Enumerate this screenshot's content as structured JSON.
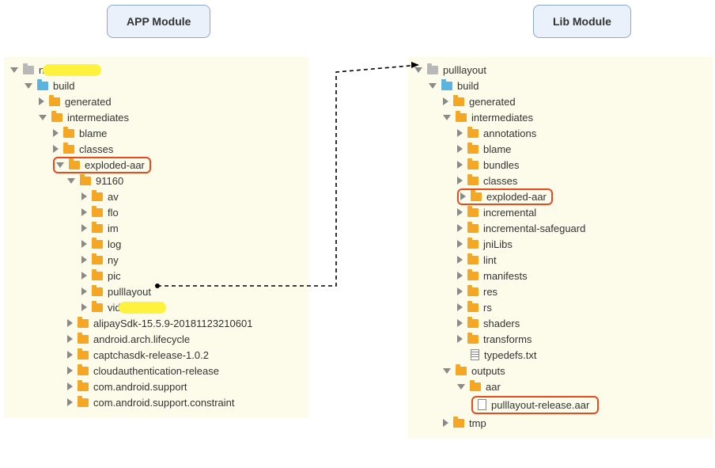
{
  "titles": {
    "app": "APP Module",
    "lib": "Lib Module"
  },
  "app": {
    "root": "n",
    "build": "build",
    "generated": "generated",
    "intermediates": "intermediates",
    "blame": "blame",
    "classes": "classes",
    "exploded": "exploded-aar",
    "dir91160": "91160",
    "av": "av",
    "flo": "flo",
    "im": "im",
    "log": "log",
    "ny": "ny",
    "pic": "pic",
    "pulllayout": "pulllayout",
    "vid": "vid",
    "alipay": "alipaySdk-15.5.9-20181123210601",
    "arch": "android.arch.lifecycle",
    "captcha": "captchasdk-release-1.0.2",
    "cloudauth": "cloudauthentication-release",
    "support": "com.android.support",
    "constraint": "com.android.support.constraint"
  },
  "lib": {
    "root": "pulllayout",
    "build": "build",
    "generated": "generated",
    "intermediates": "intermediates",
    "annotations": "annotations",
    "blame": "blame",
    "bundles": "bundles",
    "classes": "classes",
    "exploded": "exploded-aar",
    "incremental": "incremental",
    "incremental_safeguard": "incremental-safeguard",
    "jniLibs": "jniLibs",
    "lint": "lint",
    "manifests": "manifests",
    "res": "res",
    "rs": "rs",
    "shaders": "shaders",
    "transforms": "transforms",
    "typedefs": "typedefs.txt",
    "outputs": "outputs",
    "aar": "aar",
    "aarfile": "pulllayout-release.aar",
    "tmp": "tmp"
  }
}
